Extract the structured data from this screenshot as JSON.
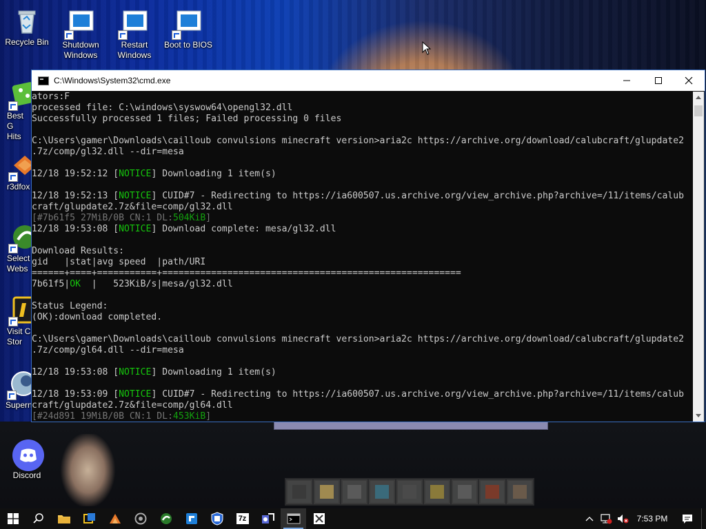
{
  "desktop": {
    "icons": [
      {
        "label_1": "Recycle Bin",
        "label_2": "",
        "icon": "recycle-bin-icon"
      },
      {
        "label_1": "Shutdown",
        "label_2": "Windows",
        "icon": "shutdown-shortcut-icon"
      },
      {
        "label_1": "Restart",
        "label_2": "Windows",
        "icon": "restart-shortcut-icon"
      },
      {
        "label_1": "Boot to BIOS",
        "label_2": "",
        "icon": "boot-bios-shortcut-icon"
      },
      {
        "label_1": "Best G",
        "label_2": "Hits",
        "icon": "best-games-icon"
      },
      {
        "label_1": "r3dfox",
        "label_2": "",
        "icon": "r3dfox-icon"
      },
      {
        "label_1": "Select",
        "label_2": "Webs",
        "icon": "select-web-icon"
      },
      {
        "label_1": "Visit C",
        "label_2": "Stor",
        "icon": "visit-store-icon"
      },
      {
        "label_1": "Supern",
        "label_2": "",
        "icon": "supernova-icon"
      },
      {
        "label_1": "Discord",
        "label_2": "",
        "icon": "discord-icon"
      }
    ]
  },
  "window": {
    "title": "C:\\Windows\\System32\\cmd.exe",
    "controls": {
      "minimize": "minimize-icon",
      "maximize": "maximize-icon",
      "close": "close-icon"
    }
  },
  "console": {
    "lines": [
      [
        {
          "t": "ators:F",
          "c": ""
        }
      ],
      [
        {
          "t": "processed file: C:\\windows\\syswow64\\opengl32.dll",
          "c": ""
        }
      ],
      [
        {
          "t": "Successfully processed 1 files; Failed processing 0 files",
          "c": ""
        }
      ],
      [
        {
          "t": "",
          "c": ""
        }
      ],
      [
        {
          "t": "C:\\Users\\gamer\\Downloads\\cailloub convulsions minecraft version>aria2c https://archive.org/download/calubcraft/glupdate2",
          "c": ""
        }
      ],
      [
        {
          "t": ".7z/comp/gl32.dll --dir=mesa",
          "c": ""
        }
      ],
      [
        {
          "t": "",
          "c": ""
        }
      ],
      [
        {
          "t": "12/18 19:52:12 [",
          "c": ""
        },
        {
          "t": "NOTICE",
          "c": "g"
        },
        {
          "t": "] Downloading 1 item(s)",
          "c": ""
        }
      ],
      [
        {
          "t": "",
          "c": ""
        }
      ],
      [
        {
          "t": "12/18 19:52:13 [",
          "c": ""
        },
        {
          "t": "NOTICE",
          "c": "g"
        },
        {
          "t": "] CUID#7 - Redirecting to https://ia600507.us.archive.org/view_archive.php?archive=/11/items/calub",
          "c": ""
        }
      ],
      [
        {
          "t": "craft/glupdate2.7z&file=comp/gl32.dll",
          "c": ""
        }
      ],
      [
        {
          "t": "[#7b61f5 27MiB/0B CN:1 DL:",
          "c": "dim"
        },
        {
          "t": "504KiB",
          "c": "dg"
        },
        {
          "t": "]",
          "c": "dim"
        }
      ],
      [
        {
          "t": "12/18 19:53:08 [",
          "c": ""
        },
        {
          "t": "NOTICE",
          "c": "g"
        },
        {
          "t": "] Download complete: mesa/gl32.dll",
          "c": ""
        }
      ],
      [
        {
          "t": "",
          "c": ""
        }
      ],
      [
        {
          "t": "Download Results:",
          "c": ""
        }
      ],
      [
        {
          "t": "gid   |stat|avg speed  |path/URI",
          "c": ""
        }
      ],
      [
        {
          "t": "======+====+===========+=======================================================",
          "c": ""
        }
      ],
      [
        {
          "t": "7b61f5|",
          "c": ""
        },
        {
          "t": "OK",
          "c": "g"
        },
        {
          "t": "  |   523KiB/s|mesa/gl32.dll",
          "c": ""
        }
      ],
      [
        {
          "t": "",
          "c": ""
        }
      ],
      [
        {
          "t": "Status Legend:",
          "c": ""
        }
      ],
      [
        {
          "t": "(OK):download completed.",
          "c": ""
        }
      ],
      [
        {
          "t": "",
          "c": ""
        }
      ],
      [
        {
          "t": "C:\\Users\\gamer\\Downloads\\cailloub convulsions minecraft version>aria2c https://archive.org/download/calubcraft/glupdate2",
          "c": ""
        }
      ],
      [
        {
          "t": ".7z/comp/gl64.dll --dir=mesa",
          "c": ""
        }
      ],
      [
        {
          "t": "",
          "c": ""
        }
      ],
      [
        {
          "t": "12/18 19:53:08 [",
          "c": ""
        },
        {
          "t": "NOTICE",
          "c": "g"
        },
        {
          "t": "] Downloading 1 item(s)",
          "c": ""
        }
      ],
      [
        {
          "t": "",
          "c": ""
        }
      ],
      [
        {
          "t": "12/18 19:53:09 [",
          "c": ""
        },
        {
          "t": "NOTICE",
          "c": "g"
        },
        {
          "t": "] CUID#7 - Redirecting to https://ia600507.us.archive.org/view_archive.php?archive=/11/items/calub",
          "c": ""
        }
      ],
      [
        {
          "t": "craft/glupdate2.7z&file=comp/gl64.dll",
          "c": ""
        }
      ],
      [
        {
          "t": "[#24d891 19MiB/0B CN:1 DL:",
          "c": "dim"
        },
        {
          "t": "453KiB",
          "c": "dg"
        },
        {
          "t": "]",
          "c": "dim"
        }
      ]
    ]
  },
  "taskbar": {
    "items": [
      {
        "name": "start-button",
        "icon": "windows-logo-icon"
      },
      {
        "name": "search-button",
        "icon": "search-icon"
      },
      {
        "name": "file-explorer-button",
        "icon": "folder-icon"
      },
      {
        "name": "taskbar-app-2",
        "icon": "app-icon"
      },
      {
        "name": "taskbar-app-3",
        "icon": "app-icon"
      },
      {
        "name": "taskbar-app-4",
        "icon": "app-icon"
      },
      {
        "name": "taskbar-app-5",
        "icon": "app-icon"
      },
      {
        "name": "taskbar-app-6",
        "icon": "app-icon"
      },
      {
        "name": "taskbar-app-7",
        "icon": "app-icon"
      },
      {
        "name": "7zip-button",
        "icon": "7zip-icon"
      },
      {
        "name": "taskbar-app-9",
        "icon": "app-icon"
      },
      {
        "name": "cmd-button",
        "icon": "cmd-icon"
      },
      {
        "name": "taskbar-app-11",
        "icon": "app-icon"
      }
    ],
    "clock": "7:53 PM",
    "zip_label": "7z"
  }
}
